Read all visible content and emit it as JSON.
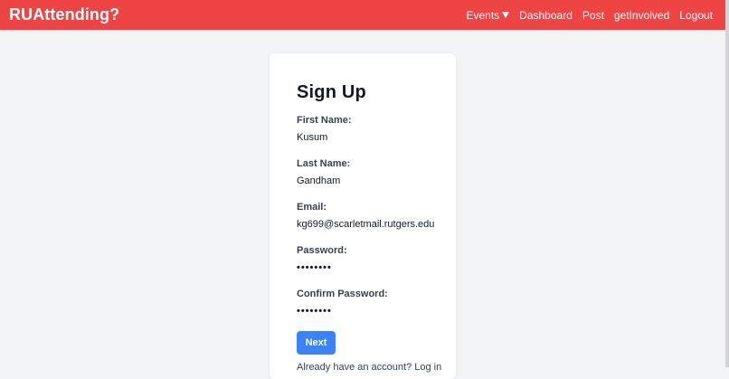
{
  "navbar": {
    "brand": "RUAttending?",
    "links": {
      "events": "Events",
      "dashboard": "Dashboard",
      "post": "Post",
      "get_involved": "getInvolved",
      "logout": "Logout"
    },
    "events_icon": "caret-down-icon",
    "background_color": "#ef4444"
  },
  "form": {
    "title": "Sign Up",
    "first_name": {
      "label": "First Name:",
      "value": "Kusum"
    },
    "last_name": {
      "label": "Last Name:",
      "value": "Gandham"
    },
    "email": {
      "label": "Email:",
      "value": "kg699@scarletmail.rutgers.edu"
    },
    "password": {
      "label": "Password:",
      "value": "••••••••"
    },
    "confirm_password": {
      "label": "Confirm Password:",
      "value": "••••••••"
    },
    "next_label": "Next",
    "next_color": "#3b82f6",
    "login_prompt": "Already have an account?",
    "login_link": "Log in"
  }
}
